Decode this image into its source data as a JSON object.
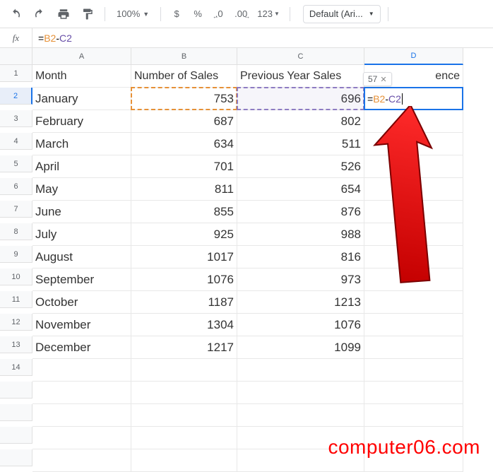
{
  "toolbar": {
    "zoom": "100%",
    "currency": "$",
    "percent": "%",
    "dec_dec": ".0",
    "dec_inc": ".00",
    "num_format": "123",
    "font": "Default (Ari..."
  },
  "formula_bar": {
    "fx": "fx",
    "eq": "=",
    "ref1": "B2",
    "op": "-",
    "ref2": "C2"
  },
  "columns": [
    "A",
    "B",
    "C",
    "D"
  ],
  "headers": {
    "A": "Month",
    "B": "Number of Sales",
    "C": "Previous Year Sales",
    "D_suffix": "ence"
  },
  "active_cell": {
    "coord": "D2",
    "result_preview": "57",
    "formula": {
      "eq": "=",
      "ref1": "B2",
      "op": "-",
      "ref2": "C2"
    }
  },
  "rows": [
    {
      "n": 1
    },
    {
      "n": 2,
      "month": "January",
      "sales": "753",
      "prev": "696"
    },
    {
      "n": 3,
      "month": "February",
      "sales": "687",
      "prev": "802"
    },
    {
      "n": 4,
      "month": "March",
      "sales": "634",
      "prev": "511"
    },
    {
      "n": 5,
      "month": "April",
      "sales": "701",
      "prev": "526"
    },
    {
      "n": 6,
      "month": "May",
      "sales": "811",
      "prev": "654"
    },
    {
      "n": 7,
      "month": "June",
      "sales": "855",
      "prev": "876"
    },
    {
      "n": 8,
      "month": "July",
      "sales": "925",
      "prev": "988"
    },
    {
      "n": 9,
      "month": "August",
      "sales": "1017",
      "prev": "816"
    },
    {
      "n": 10,
      "month": "September",
      "sales": "1076",
      "prev": "973"
    },
    {
      "n": 11,
      "month": "October",
      "sales": "1187",
      "prev": "1213"
    },
    {
      "n": 12,
      "month": "November",
      "sales": "1304",
      "prev": "1076"
    },
    {
      "n": 13,
      "month": "December",
      "sales": "1217",
      "prev": "1099"
    },
    {
      "n": 14
    }
  ],
  "watermark": "computer06.com",
  "chart_data": {
    "type": "table",
    "title": "",
    "columns": [
      "Month",
      "Number of Sales",
      "Previous Year Sales"
    ],
    "rows": [
      [
        "January",
        753,
        696
      ],
      [
        "February",
        687,
        802
      ],
      [
        "March",
        634,
        511
      ],
      [
        "April",
        701,
        526
      ],
      [
        "May",
        811,
        654
      ],
      [
        "June",
        855,
        876
      ],
      [
        "July",
        925,
        988
      ],
      [
        "August",
        1017,
        816
      ],
      [
        "September",
        1076,
        973
      ],
      [
        "October",
        1187,
        1213
      ],
      [
        "November",
        1304,
        1076
      ],
      [
        "December",
        1217,
        1099
      ]
    ]
  }
}
